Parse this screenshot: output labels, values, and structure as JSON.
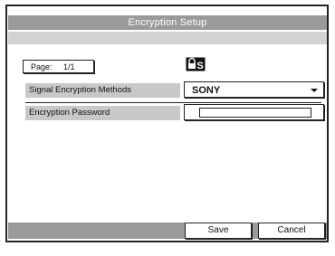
{
  "window": {
    "title": "Encryption Setup"
  },
  "page": {
    "label": "Page:",
    "value": "1/1"
  },
  "icons": {
    "lock": "lock-s-icon"
  },
  "settings": {
    "signal_encryption": {
      "label": "Signal Encryption Methods",
      "value": "SONY"
    },
    "encryption_password": {
      "label": "Encryption Password",
      "value": ""
    }
  },
  "footer": {
    "save_label": "Save",
    "cancel_label": "Cancel"
  }
}
